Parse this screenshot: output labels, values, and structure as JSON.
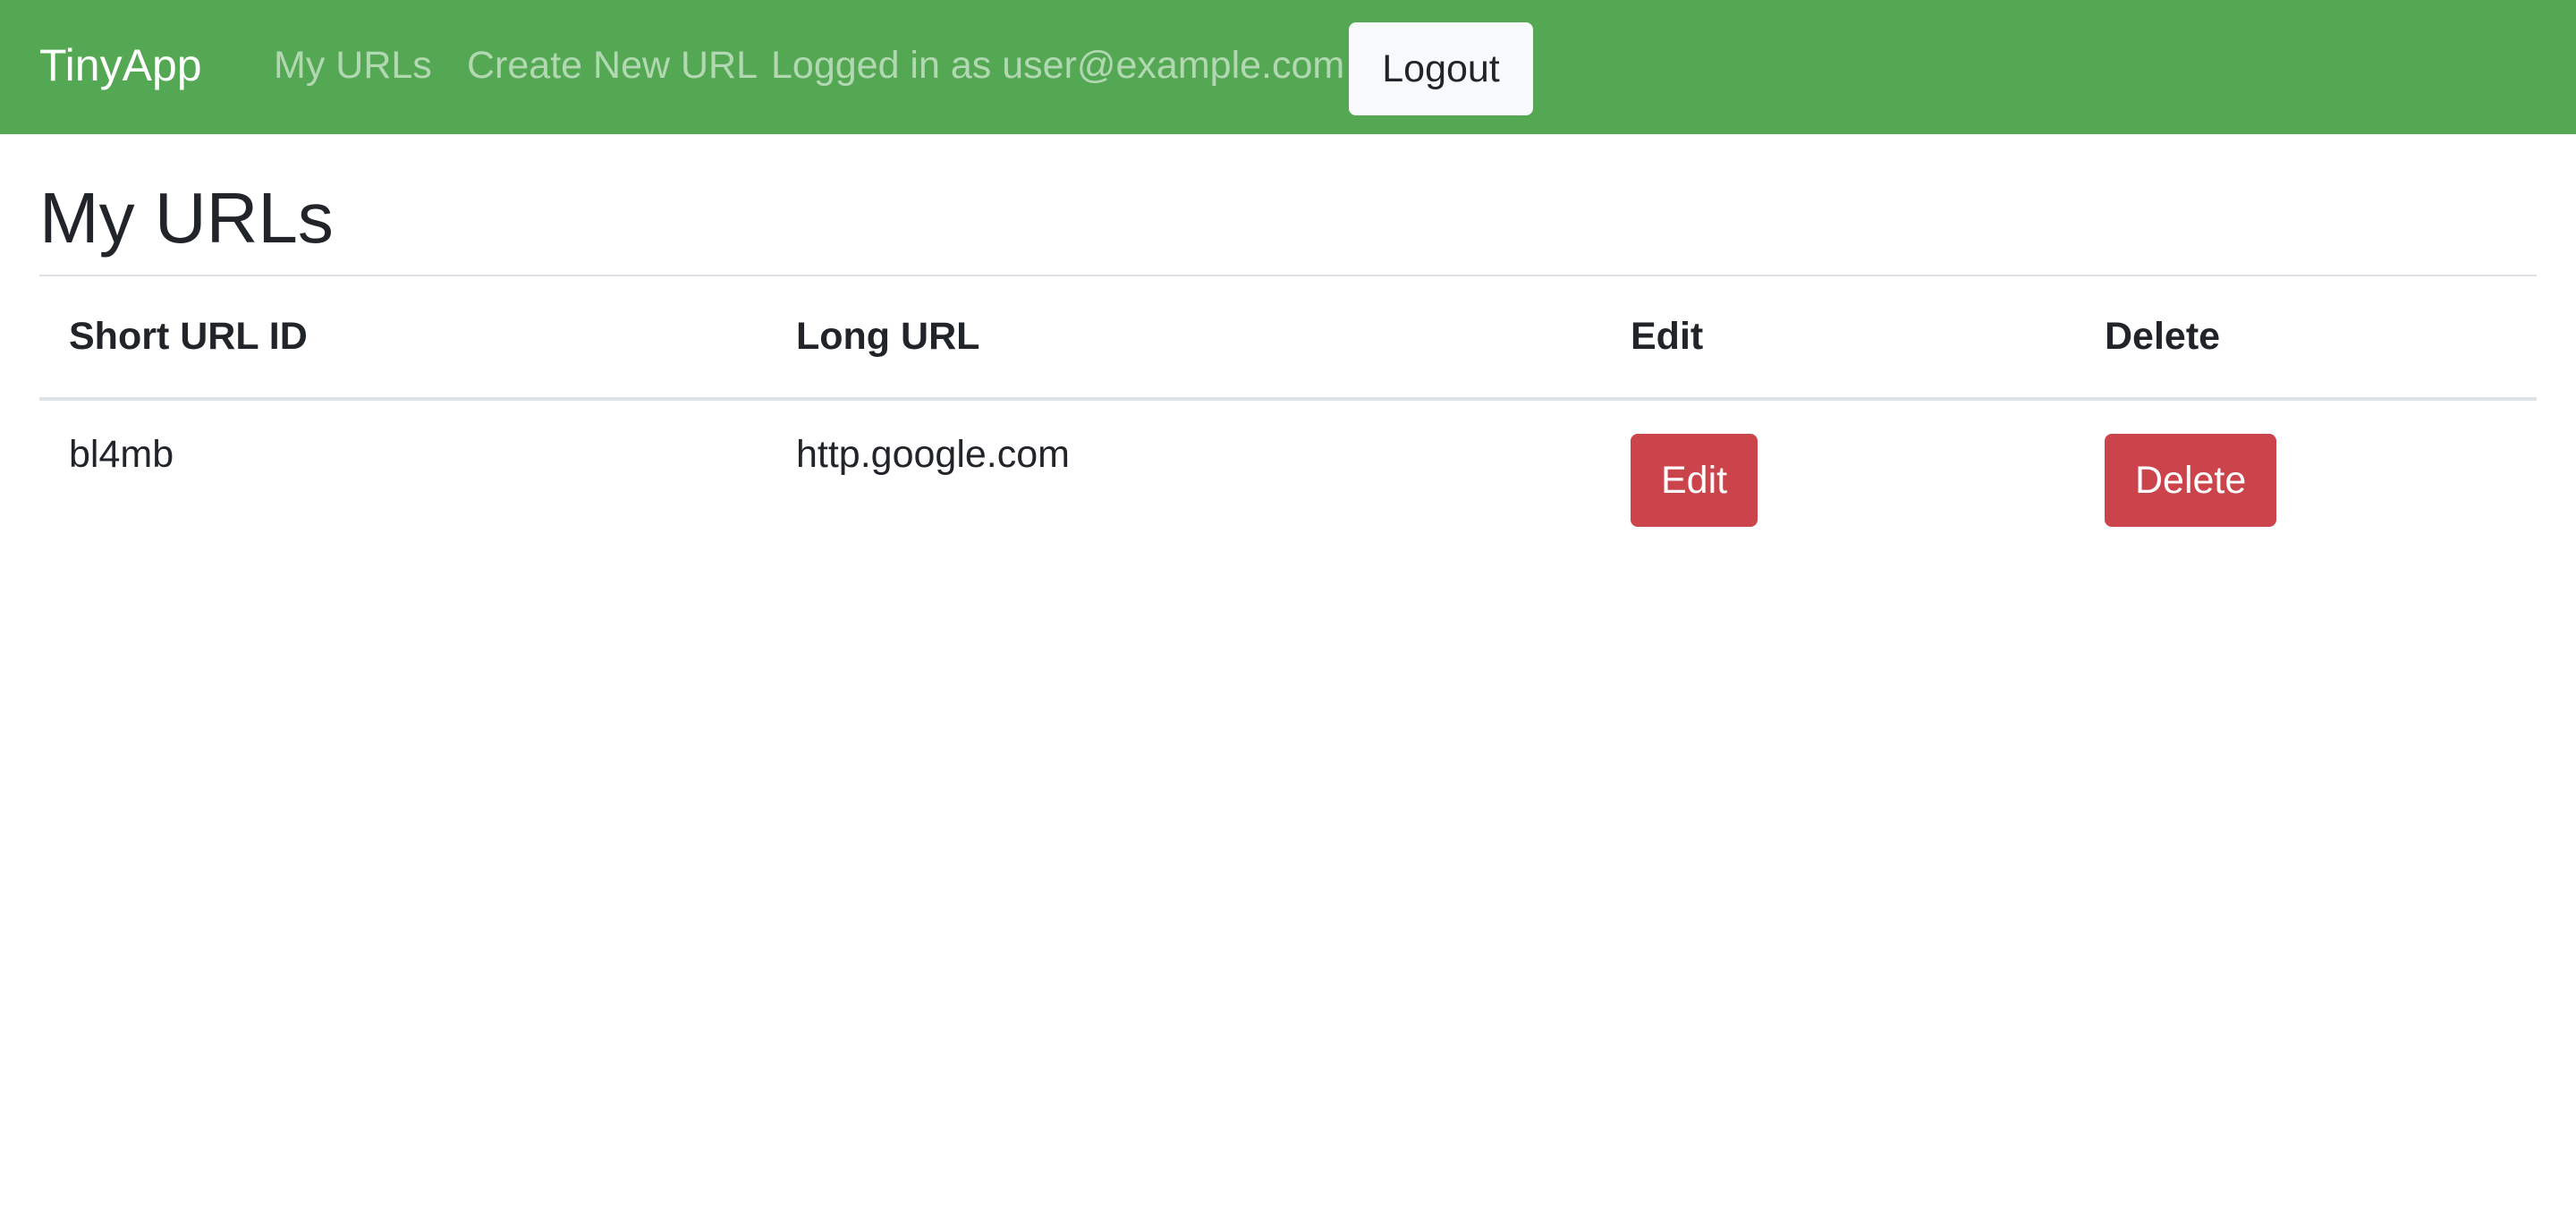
{
  "navbar": {
    "brand": "TinyApp",
    "links": {
      "my_urls": "My URLs",
      "create_new_url": "Create New URL"
    },
    "user_status": "Logged in as user@example.com",
    "logout_label": "Logout",
    "background_color": "#54a854"
  },
  "main": {
    "title": "My URLs",
    "table": {
      "headers": {
        "short_url_id": "Short URL ID",
        "long_url": "Long URL",
        "edit": "Edit",
        "delete": "Delete"
      },
      "rows": [
        {
          "short_url_id": "bl4mb",
          "long_url": "http.google.com",
          "edit_label": "Edit",
          "delete_label": "Delete"
        }
      ]
    },
    "danger_color": "#cc444b"
  }
}
